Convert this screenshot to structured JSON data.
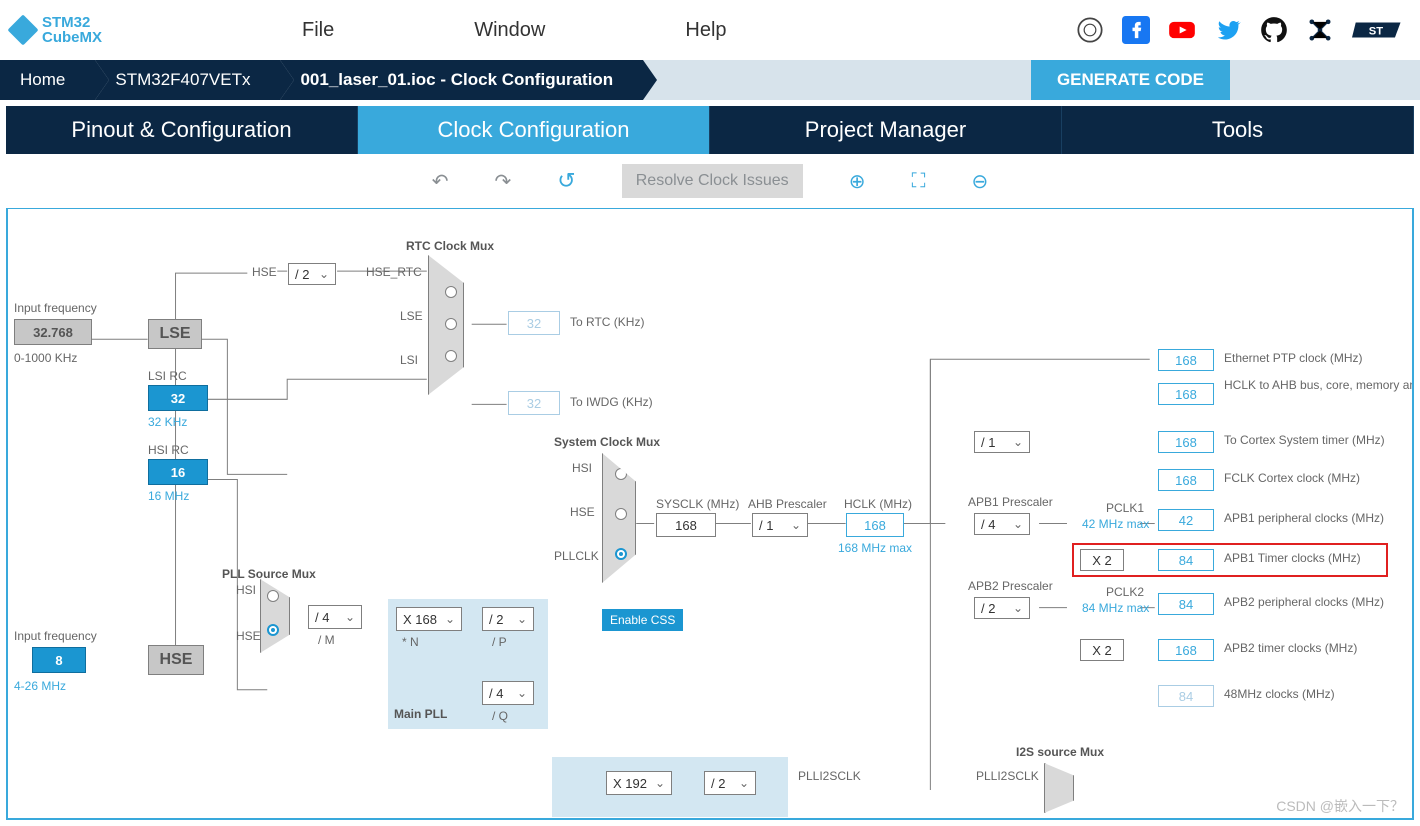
{
  "app": {
    "logo_line1": "STM32",
    "logo_line2": "CubeMX"
  },
  "menu": {
    "file": "File",
    "window": "Window",
    "help": "Help"
  },
  "breadcrumb": {
    "home": "Home",
    "chip": "STM32F407VETx",
    "file": "001_laser_01.ioc - Clock Configuration"
  },
  "generate": "GENERATE CODE",
  "tabs": {
    "pinout": "Pinout & Configuration",
    "clock": "Clock Configuration",
    "project": "Project Manager",
    "tools": "Tools"
  },
  "toolbar": {
    "undo": "↶",
    "redo": "↷",
    "reset": "↺",
    "resolve": "Resolve Clock Issues",
    "zoom_in": "⊕",
    "fit": "⛶",
    "zoom_out": "⊖"
  },
  "diagram": {
    "input_freq_lse_lbl": "Input frequency",
    "lse_value": "32.768",
    "lse_range": "0-1000 KHz",
    "lse_name": "LSE",
    "hse_div2": "/ 2",
    "hse_rtc": "HSE_RTC",
    "hse_lbl": "HSE",
    "lse_lbl": "LSE",
    "lsi_lbl": "LSI",
    "rtc_mux": "RTC Clock Mux",
    "to_rtc": "To RTC (KHz)",
    "rtc_out": "32",
    "iwdg_out": "32",
    "to_iwdg": "To IWDG (KHz)",
    "lsi_rc": "LSI RC",
    "lsi_val": "32",
    "lsi_khz": "32 KHz",
    "hsi_rc": "HSI RC",
    "hsi_val": "16",
    "hsi_mhz": "16 MHz",
    "sys_mux": "System Clock Mux",
    "hsi": "HSI",
    "hse": "HSE",
    "pllclk": "PLLCLK",
    "enable_css": "Enable CSS",
    "sysclk_lbl": "SYSCLK (MHz)",
    "sysclk": "168",
    "ahb_pre": "AHB Prescaler",
    "ahb_div": "/ 1",
    "hclk_lbl": "HCLK (MHz)",
    "hclk": "168",
    "hclk_max": "168 MHz max",
    "sys_div": "/ 1",
    "apb1_pre": "APB1 Prescaler",
    "apb1_div": "/ 4",
    "apb2_pre": "APB2 Prescaler",
    "apb2_div": "/ 2",
    "pclk1": "PCLK1",
    "pclk1_max": "42 MHz max",
    "pclk2": "PCLK2",
    "pclk2_max": "84 MHz max",
    "x2": "X 2",
    "eth_ptp_lbl": "Ethernet PTP clock (MHz)",
    "eth_ptp": "168",
    "hclk_ahb_lbl": "HCLK to AHB bus, core, memory and DMA (MHz)",
    "hclk_ahb": "168",
    "cortex_sys_lbl": "To Cortex System timer (MHz)",
    "cortex_sys": "168",
    "fclk_lbl": "FCLK Cortex clock (MHz)",
    "fclk": "168",
    "apb1_p_lbl": "APB1 peripheral clocks (MHz)",
    "apb1_p": "42",
    "apb1_t_lbl": "APB1 Timer clocks (MHz)",
    "apb1_t": "84",
    "apb2_p_lbl": "APB2 peripheral clocks (MHz)",
    "apb2_p": "84",
    "apb2_t_lbl": "APB2 timer clocks (MHz)",
    "apb2_t": "168",
    "48m_lbl": "48MHz clocks (MHz)",
    "48m": "84",
    "input_freq_hse_lbl": "Input frequency",
    "hse_in": "8",
    "hse_range": "4-26 MHz",
    "hse_name": "HSE",
    "pll_src": "PLL Source Mux",
    "pll_hsi": "HSI",
    "pll_hse": "HSE",
    "pll_m": "/ 4",
    "pll_m_lbl": "/ M",
    "main_pll": "Main PLL",
    "pll_n": "X 168",
    "pll_n_lbl": "* N",
    "pll_p": "/ 2",
    "pll_p_lbl": "/ P",
    "pll_q": "/ 4",
    "pll_q_lbl": "/ Q",
    "plli2s_n": "X 192",
    "plli2s_div": "/ 2",
    "plli2sclk": "PLLI2SCLK",
    "i2s_mux": "I2S source Mux",
    "watermark": "CSDN @嵌入一下？"
  }
}
